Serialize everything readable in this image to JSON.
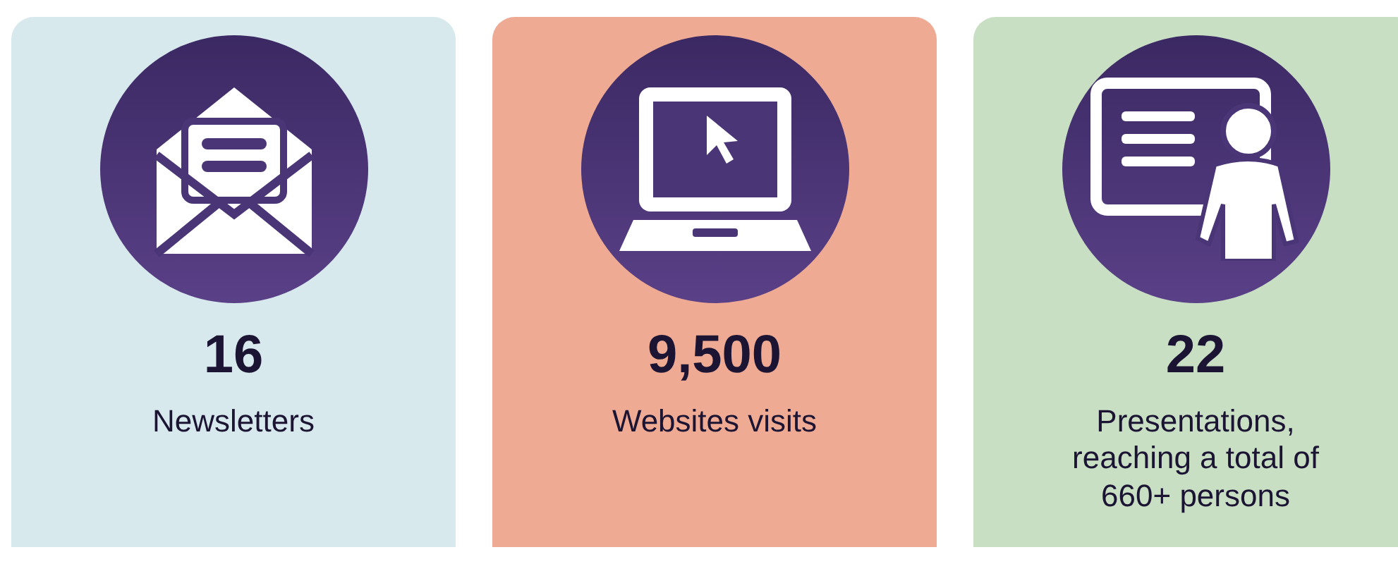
{
  "stats": [
    {
      "kind": "envelope",
      "color": "#d8e9ee",
      "value": "16",
      "label": "Newsletters"
    },
    {
      "kind": "laptop",
      "color": "#eeaa93",
      "value": "9,500",
      "label": "Websites visits"
    },
    {
      "kind": "presenter",
      "color": "#c8dfc4",
      "value": "22",
      "label": "Presentations, reaching a total of 660+ persons"
    }
  ]
}
